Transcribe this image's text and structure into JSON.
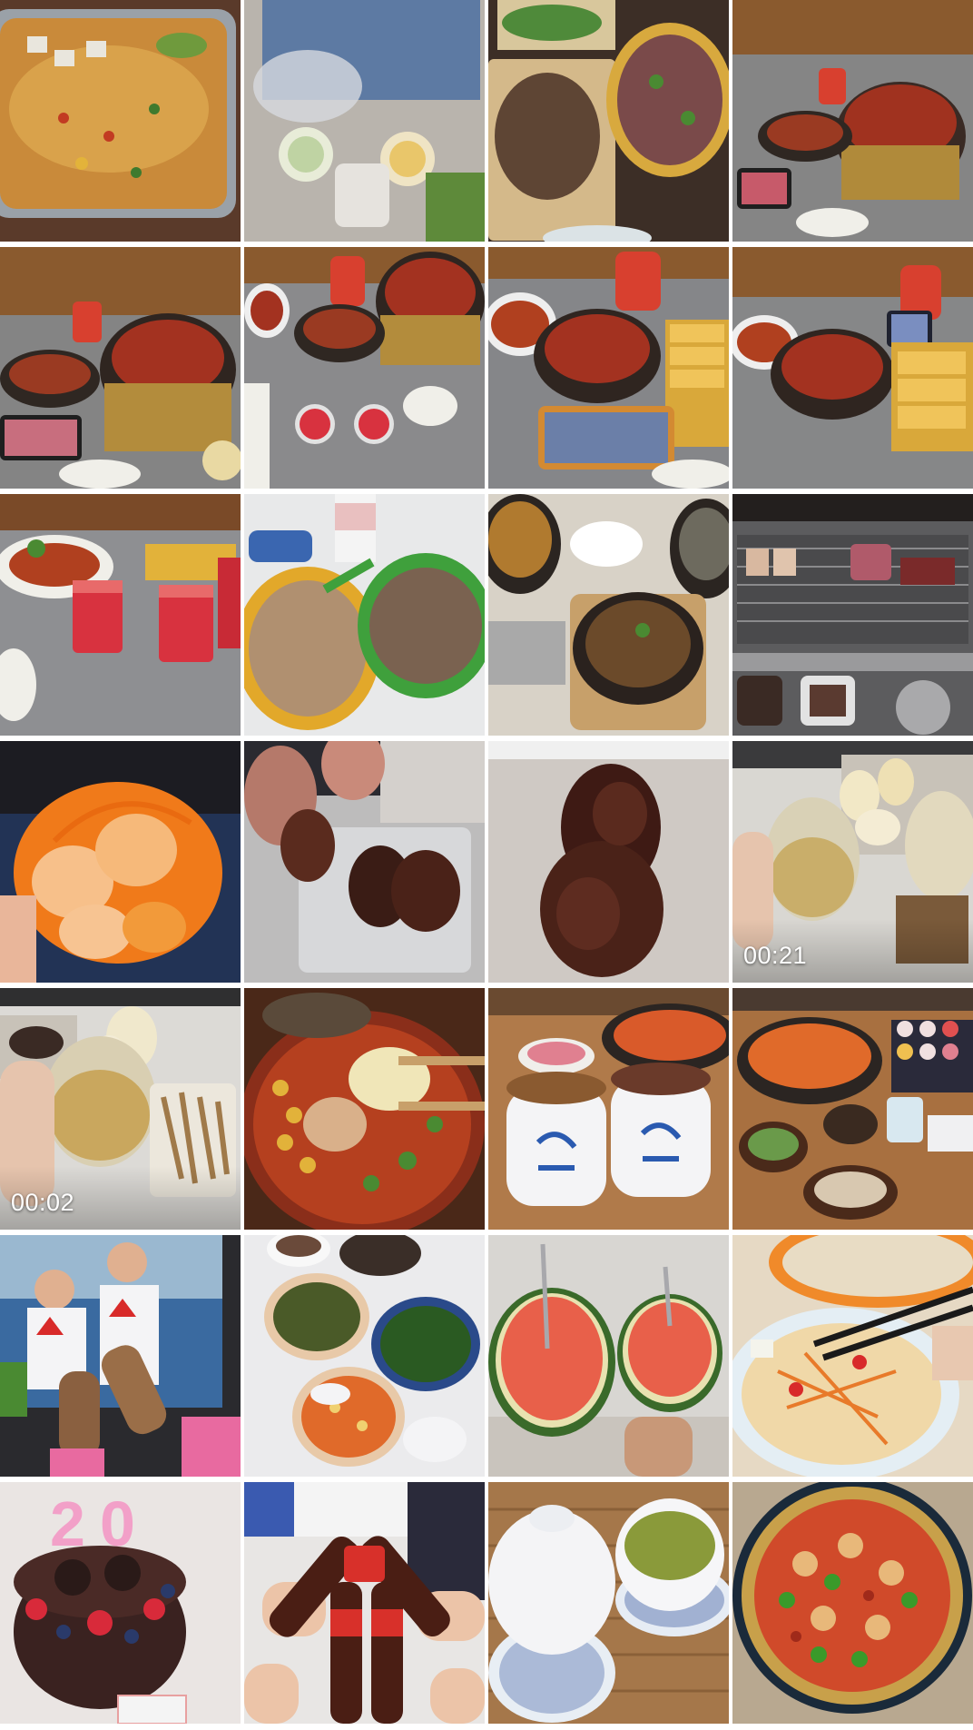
{
  "gallery": {
    "columns": 4,
    "rows": 7,
    "items": [
      {
        "type": "photo",
        "icon": "grilled-fish-photo"
      },
      {
        "type": "photo",
        "icon": "takeout-drinks-photo"
      },
      {
        "type": "photo",
        "icon": "stir-fry-dishes-photo"
      },
      {
        "type": "photo",
        "icon": "clay-pot-dishes-photo"
      },
      {
        "type": "photo",
        "icon": "clay-pot-dishes-photo"
      },
      {
        "type": "photo",
        "icon": "clay-pot-dishes-photo"
      },
      {
        "type": "photo",
        "icon": "clay-pot-dishes-photo"
      },
      {
        "type": "photo",
        "icon": "clay-pot-dishes-photo"
      },
      {
        "type": "photo",
        "icon": "watermelon-juice-photo"
      },
      {
        "type": "photo",
        "icon": "fried-rice-photo"
      },
      {
        "type": "photo",
        "icon": "stone-pot-photo"
      },
      {
        "type": "photo",
        "icon": "bbq-grill-photo"
      },
      {
        "type": "photo",
        "icon": "orange-photo"
      },
      {
        "type": "photo",
        "icon": "duck-neck-photo"
      },
      {
        "type": "photo",
        "icon": "duck-neck-photo"
      },
      {
        "type": "video",
        "icon": "drinks-video",
        "duration": "00:21"
      },
      {
        "type": "video",
        "icon": "drinks-video",
        "duration": "00:02"
      },
      {
        "type": "photo",
        "icon": "spicy-stew-photo"
      },
      {
        "type": "photo",
        "icon": "hotpot-cups-photo"
      },
      {
        "type": "photo",
        "icon": "hotpot-table-photo"
      },
      {
        "type": "photo",
        "icon": "ice-cream-tv-photo"
      },
      {
        "type": "photo",
        "icon": "home-meal-photo"
      },
      {
        "type": "photo",
        "icon": "watermelon-photo"
      },
      {
        "type": "photo",
        "icon": "papaya-salad-photo"
      },
      {
        "type": "photo",
        "icon": "birthday-cake-photo"
      },
      {
        "type": "photo",
        "icon": "beer-toast-photo"
      },
      {
        "type": "photo",
        "icon": "tea-cups-photo"
      },
      {
        "type": "photo",
        "icon": "spicy-chicken-photo"
      }
    ]
  }
}
